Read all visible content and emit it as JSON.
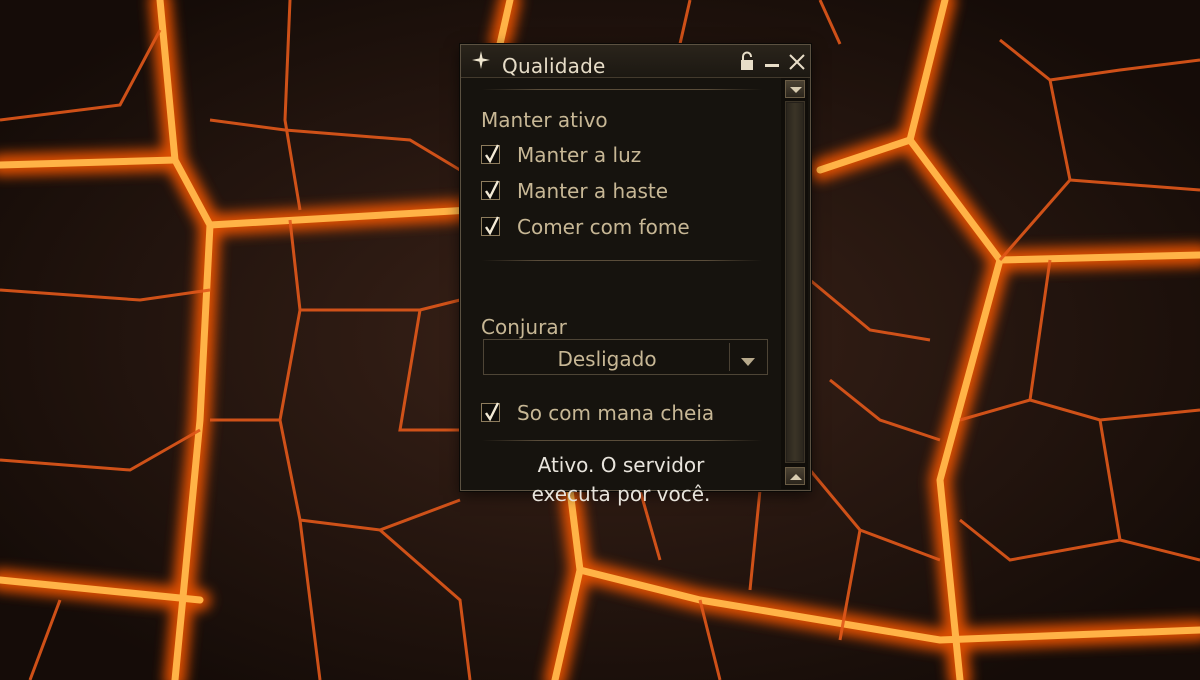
{
  "window": {
    "title": "Qualidade",
    "title_icon": "sparkle-icon",
    "controls": [
      "lock-icon",
      "minimize-icon",
      "close-icon"
    ]
  },
  "keep_active": {
    "label": "Manter ativo",
    "items": [
      {
        "label": "Manter a luz",
        "checked": true
      },
      {
        "label": "Manter a haste",
        "checked": true
      },
      {
        "label": "Comer com fome",
        "checked": true
      }
    ]
  },
  "conjure": {
    "label": "Conjurar",
    "selected": "Desligado",
    "full_mana_only": {
      "label": "So com mana cheia",
      "checked": true
    }
  },
  "status": {
    "line1": "Ativo. O servidor",
    "line2": "executa por você."
  },
  "colors": {
    "lava": "#ff7a12",
    "panel": "#16130e",
    "text": "#c7b795",
    "border": "#5b5141"
  }
}
